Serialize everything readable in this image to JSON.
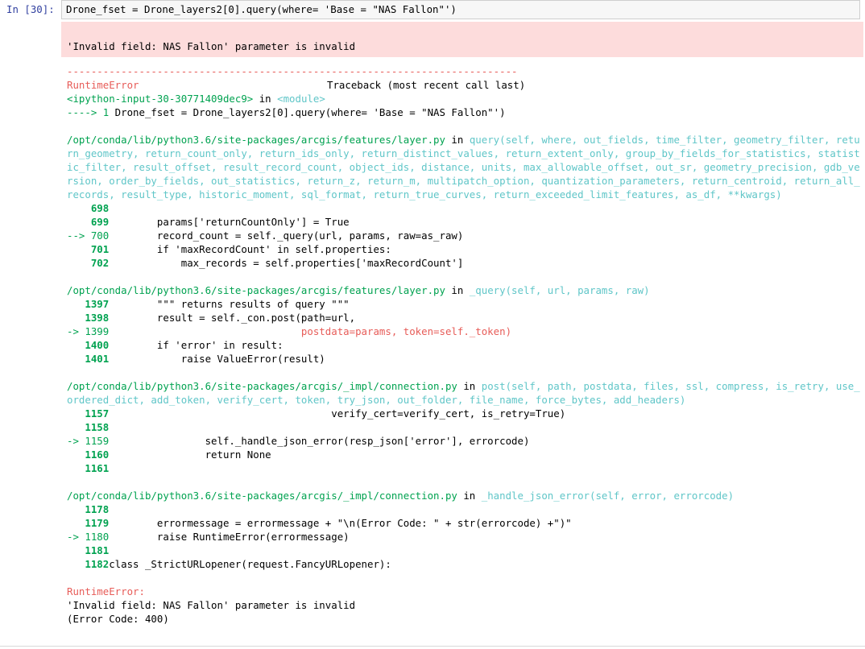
{
  "prompt": "In [30]:",
  "input_code": "Drone_fset = Drone_layers2[0].query(where= 'Base = \"NAS Fallon\"')",
  "stderr_message": "'Invalid field: NAS Fallon' parameter is invalid",
  "traceback": {
    "separator": "---------------------------------------------------------------------------",
    "error_type": "RuntimeError",
    "header_right": "Traceback (most recent call last)",
    "module_ref": "<ipython-input-30-30771409dec9>",
    "module_in": " in ",
    "module_name": "<module>",
    "arrow_line": "----> 1 Drone_fset = Drone_layers2[0].query(where= 'Base = \"NAS Fallon\"')",
    "frames": [
      {
        "file": "/opt/conda/lib/python3.6/site-packages/arcgis/features/layer.py",
        "in": " in ",
        "func": "query(self, where, out_fields, time_filter, geometry_filter, return_geometry, return_count_only, return_ids_only, return_distinct_values, return_extent_only, group_by_fields_for_statistics, statistic_filter, result_offset, result_record_count, object_ids, distance, units, max_allowable_offset, out_sr, geometry_precision, gdb_version, order_by_fields, out_statistics, return_z, return_m, multipatch_option, quantization_parameters, return_centroid, return_all_records, result_type, historic_moment, sql_format, return_true_curves, return_exceeded_limit_features, as_df, **kwargs)",
        "lines": [
          {
            "no": "    698",
            "code": ""
          },
          {
            "no": "    699",
            "code": "        params['returnCountOnly'] = True"
          },
          {
            "no": "--> 700",
            "code": "        record_count = self._query(url, params, raw=as_raw)"
          },
          {
            "no": "    701",
            "code": "        if 'maxRecordCount' in self.properties:"
          },
          {
            "no": "    702",
            "code": "            max_records = self.properties['maxRecordCount']"
          }
        ]
      },
      {
        "file": "/opt/conda/lib/python3.6/site-packages/arcgis/features/layer.py",
        "in": " in ",
        "func": "_query(self, url, params, raw)",
        "lines": [
          {
            "no": "   1397",
            "code": "        \"\"\" returns results of query \"\"\""
          },
          {
            "no": "   1398",
            "code": "        result = self._con.post(path=url,"
          },
          {
            "no": "-> 1399",
            "code": "                                postdata=params, token=self._token)"
          },
          {
            "no": "   1400",
            "code": "        if 'error' in result:"
          },
          {
            "no": "   1401",
            "code": "            raise ValueError(result)"
          }
        ]
      },
      {
        "file": "/opt/conda/lib/python3.6/site-packages/arcgis/_impl/connection.py",
        "in": " in ",
        "func": "post(self, path, postdata, files, ssl, compress, is_retry, use_ordered_dict, add_token, verify_cert, token, try_json, out_folder, file_name, force_bytes, add_headers)",
        "lines": [
          {
            "no": "   1157",
            "code": "                                     verify_cert=verify_cert, is_retry=True)"
          },
          {
            "no": "   1158",
            "code": ""
          },
          {
            "no": "-> 1159",
            "code": "                self._handle_json_error(resp_json['error'], errorcode)"
          },
          {
            "no": "   1160",
            "code": "                return None"
          },
          {
            "no": "   1161",
            "code": ""
          }
        ]
      },
      {
        "file": "/opt/conda/lib/python3.6/site-packages/arcgis/_impl/connection.py",
        "in": " in ",
        "func": "_handle_json_error(self, error, errorcode)",
        "lines": [
          {
            "no": "   1178",
            "code": ""
          },
          {
            "no": "   1179",
            "code": "        errormessage = errormessage + \"\\n(Error Code: \" + str(errorcode) +\")\""
          },
          {
            "no": "-> 1180",
            "code": "        raise RuntimeError(errormessage)"
          },
          {
            "no": "   1181",
            "code": ""
          },
          {
            "no": "   1182",
            "code": "class _StrictURLopener(request.FancyURLopener):"
          }
        ]
      }
    ],
    "final_error_type": "RuntimeError:",
    "final_message_1": "'Invalid field: NAS Fallon' parameter is invalid",
    "final_message_2": "(Error Code: 400)"
  }
}
